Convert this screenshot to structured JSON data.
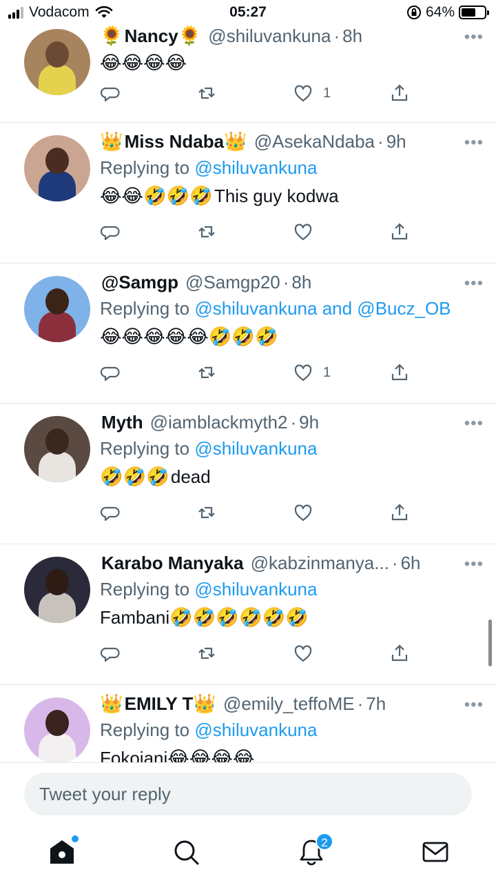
{
  "status_bar": {
    "carrier": "Vodacom",
    "time": "05:27",
    "battery": "64%",
    "battery_level": 0.64
  },
  "tweets": [
    {
      "name_prefix": "🌻",
      "name": "Nancy",
      "name_suffix": "🌻",
      "handle": "@shiluvankuna",
      "age": "8h",
      "replying_label": "",
      "replying_to": "",
      "body_emojis": "😂😂😂😂",
      "body_text": "",
      "likes": "1",
      "avatar_colors": [
        "#a8845e",
        "#e4d24f",
        "#6b4a35"
      ]
    },
    {
      "name_prefix": "👑",
      "name": "Miss Ndaba",
      "name_suffix": "👑",
      "handle": "@AsekaNdaba",
      "age": "9h",
      "replying_label": "Replying to",
      "replying_to": "@shiluvankuna",
      "body_emojis": "😂😂🤣🤣🤣",
      "body_text": "This guy kodwa",
      "likes": "",
      "avatar_colors": [
        "#c9a592",
        "#1f3a7a",
        "#4a2c22"
      ]
    },
    {
      "name_prefix": "",
      "name": "@Samgp",
      "name_suffix": "",
      "handle": "@Samgp20",
      "age": "8h",
      "replying_label": "Replying to",
      "replying_to": "@shiluvankuna and @Bucz_OB",
      "body_emojis": "😂😂😂😂😂🤣🤣🤣",
      "body_text": "",
      "likes": "1",
      "avatar_colors": [
        "#7fb2e8",
        "#8b2f3c",
        "#3a2418"
      ]
    },
    {
      "name_prefix": "",
      "name": "Myth",
      "name_suffix": "",
      "handle": "@iamblackmyth2",
      "age": "9h",
      "replying_label": "Replying to",
      "replying_to": "@shiluvankuna",
      "body_emojis": "🤣🤣🤣",
      "body_text": " dead",
      "likes": "",
      "avatar_colors": [
        "#5a4a42",
        "#e8e4df",
        "#3a2820"
      ]
    },
    {
      "name_prefix": "",
      "name": "Karabo Manyaka",
      "name_suffix": "",
      "handle": "@kabzinmanya...",
      "age": "6h",
      "replying_label": "Replying to",
      "replying_to": "@shiluvankuna",
      "body_emojis": "🤣🤣🤣🤣🤣🤣",
      "body_text": "Fambani",
      "likes": "",
      "avatar_colors": [
        "#2a2a3a",
        "#c8c2bc",
        "#2e1c14"
      ]
    },
    {
      "name_prefix": "👑",
      "name": "EMILY T",
      "name_suffix": "👑",
      "handle": "@emily_teffoME",
      "age": "7h",
      "replying_label": "Replying to",
      "replying_to": "@shiluvankuna",
      "body_emojis": "😂😂😂😂",
      "body_text": "Fokojani",
      "likes": "",
      "avatar_colors": [
        "#d7b8e8",
        "#f2f0f0",
        "#3a2420"
      ]
    }
  ],
  "reply_bar": {
    "placeholder": "Tweet your reply"
  },
  "nav": {
    "notification_count": "2"
  }
}
